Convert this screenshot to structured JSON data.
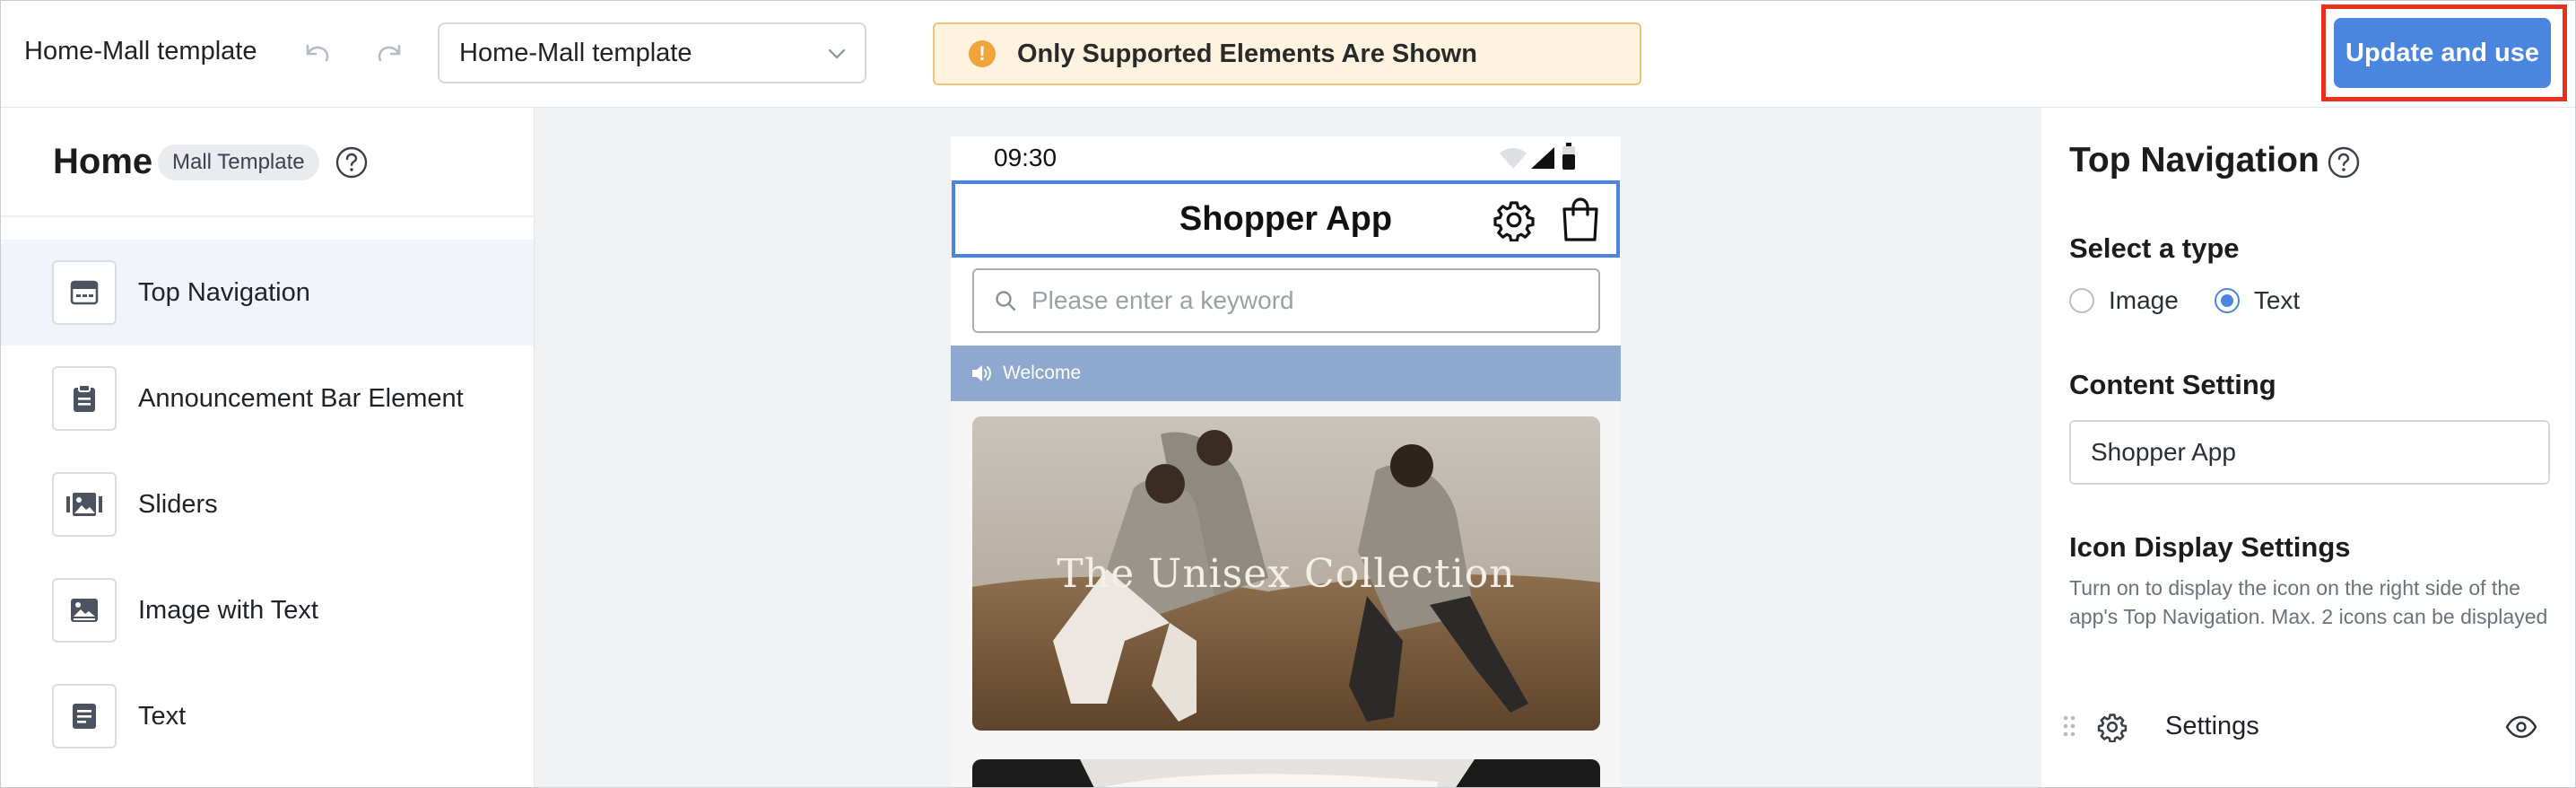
{
  "toolbar": {
    "app_title": "Home-Mall template",
    "template_select": "Home-Mall template",
    "warning": "Only Supported Elements Are Shown",
    "update_button": "Update and use"
  },
  "sidebar": {
    "title": "Home",
    "tag": "Mall Template",
    "items": [
      {
        "label": "Top Navigation",
        "icon": "top-nav-icon",
        "active": true
      },
      {
        "label": "Announcement Bar Element",
        "icon": "clipboard-icon",
        "active": false
      },
      {
        "label": "Sliders",
        "icon": "gallery-icon",
        "active": false
      },
      {
        "label": "Image with Text",
        "icon": "image-icon",
        "active": false
      },
      {
        "label": "Text",
        "icon": "document-icon",
        "active": false
      }
    ]
  },
  "preview": {
    "time": "09:30",
    "nav_title": "Shopper App",
    "search_placeholder": "Please enter a keyword",
    "announcement": "Welcome",
    "banner_caption": "The Unisex Collection"
  },
  "panel": {
    "title": "Top Navigation",
    "type_heading": "Select a type",
    "type_options": [
      {
        "label": "Image",
        "selected": false
      },
      {
        "label": "Text",
        "selected": true
      }
    ],
    "content_heading": "Content Setting",
    "content_value": "Shopper App",
    "icon_heading": "Icon Display Settings",
    "icon_description": "Turn on to display the icon on the right side of the app's Top Navigation. Max. 2 icons can be displayed",
    "icon_rows": [
      {
        "label": "Settings",
        "icon": "gear-icon",
        "visible": true
      }
    ]
  },
  "colors": {
    "accent": "#4a86e0",
    "warning_bg": "#fdf3df",
    "highlight": "#e8321e",
    "announcement_bg": "#8ea8d0"
  }
}
